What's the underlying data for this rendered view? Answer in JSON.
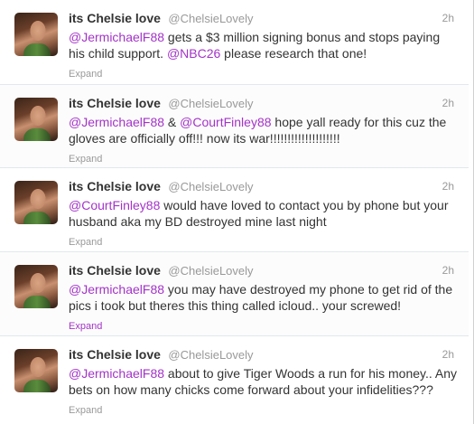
{
  "tweets": [
    {
      "fullname": "its Chelsie love",
      "username": "@ChelsieLovely",
      "time": "2h",
      "segments": [
        {
          "t": "@JermichaelF88",
          "m": true
        },
        {
          "t": " gets a $3 million signing bonus and stops paying his child support. ",
          "m": false
        },
        {
          "t": "@NBC26",
          "m": true
        },
        {
          "t": " please research that one!",
          "m": false
        }
      ],
      "expand": "Expand"
    },
    {
      "fullname": "its Chelsie love",
      "username": "@ChelsieLovely",
      "time": "2h",
      "segments": [
        {
          "t": "@JermichaelF88",
          "m": true
        },
        {
          "t": " & ",
          "m": false
        },
        {
          "t": "@CourtFinley88",
          "m": true
        },
        {
          "t": " hope yall ready for this cuz the gloves are officially off!!! now its war!!!!!!!!!!!!!!!!!!!!",
          "m": false
        }
      ],
      "expand": "Expand"
    },
    {
      "fullname": "its Chelsie love",
      "username": "@ChelsieLovely",
      "time": "2h",
      "segments": [
        {
          "t": "@CourtFinley88",
          "m": true
        },
        {
          "t": " would have loved to contact you by phone but your husband aka my BD destroyed mine last night",
          "m": false
        }
      ],
      "expand": "Expand"
    },
    {
      "fullname": "its Chelsie love",
      "username": "@ChelsieLovely",
      "time": "2h",
      "segments": [
        {
          "t": "@JermichaelF88",
          "m": true
        },
        {
          "t": " you may have destroyed my phone to get rid of the pics i took but theres this thing called icloud.. your screwed!",
          "m": false
        }
      ],
      "expand": "Expand"
    },
    {
      "fullname": "its Chelsie love",
      "username": "@ChelsieLovely",
      "time": "2h",
      "segments": [
        {
          "t": "@JermichaelF88",
          "m": true
        },
        {
          "t": " about to give Tiger Woods a run for his money.. Any bets on how many chicks come forward about your infidelities???",
          "m": false
        }
      ],
      "expand": "Expand"
    }
  ]
}
